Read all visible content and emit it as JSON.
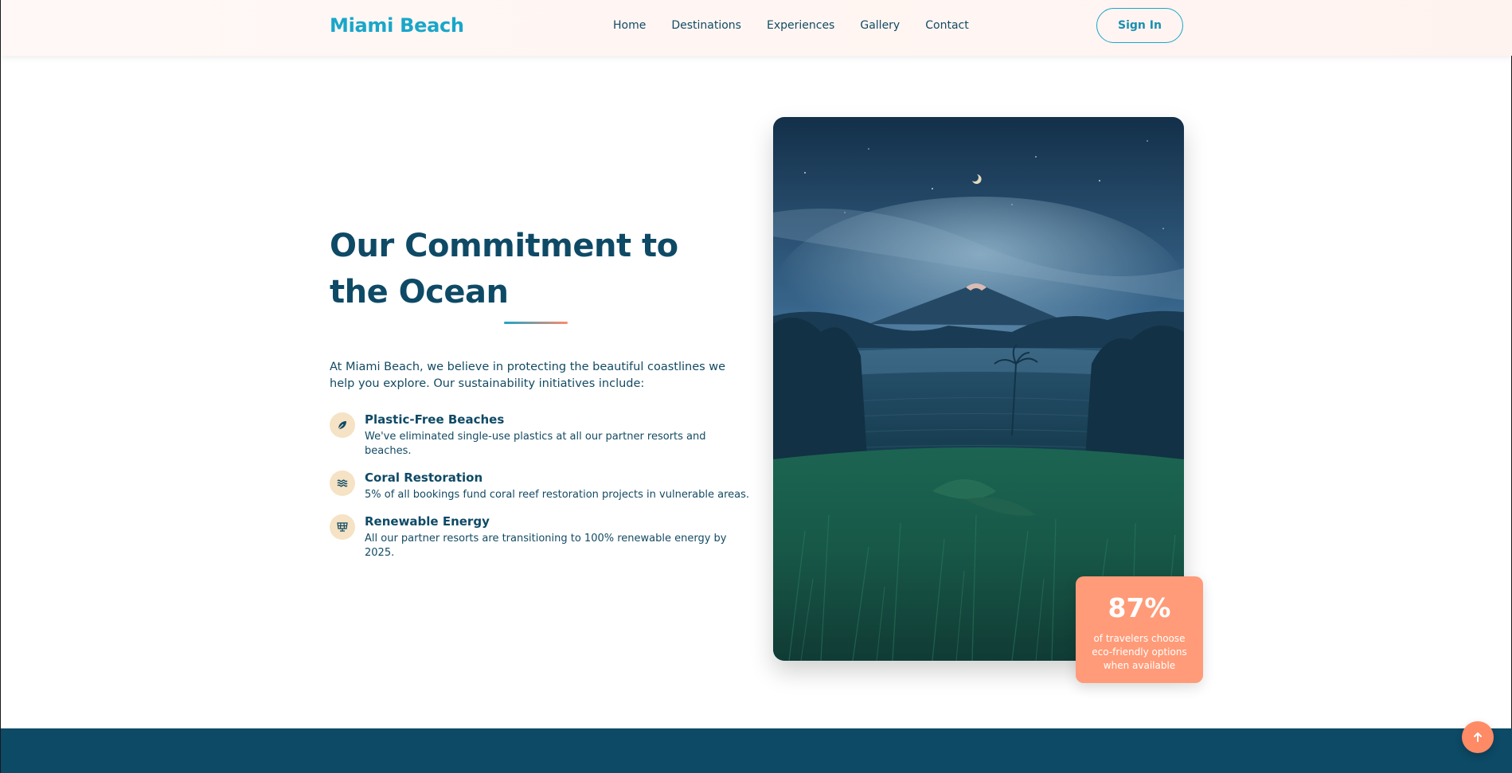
{
  "header": {
    "logo": "Miami Beach",
    "nav": [
      "Home",
      "Destinations",
      "Experiences",
      "Gallery",
      "Contact"
    ],
    "signin": "Sign In"
  },
  "commitment": {
    "title": "Our Commitment to the Ocean",
    "intro": "At Miami Beach, we believe in protecting the beautiful coastlines we help you explore. Our sustainability initiatives include:",
    "items": [
      {
        "icon": "leaf-icon",
        "title": "Plastic-Free Beaches",
        "desc": "We've eliminated single-use plastics at all our partner resorts and beaches."
      },
      {
        "icon": "water-icon",
        "title": "Coral Restoration",
        "desc": "5% of all bookings fund coral reef restoration projects in vulnerable areas."
      },
      {
        "icon": "solar-panel-icon",
        "title": "Renewable Energy",
        "desc": "All our partner resorts are transitioning to 100% renewable energy by 2025."
      }
    ]
  },
  "stat": {
    "value": "87%",
    "label": "of travelers choose eco-friendly options when available"
  },
  "colors": {
    "primary": "#0e4a66",
    "accent": "#1aa6c9",
    "coral": "#ff9b78"
  },
  "back_to_top_icon": "arrow-up-icon"
}
